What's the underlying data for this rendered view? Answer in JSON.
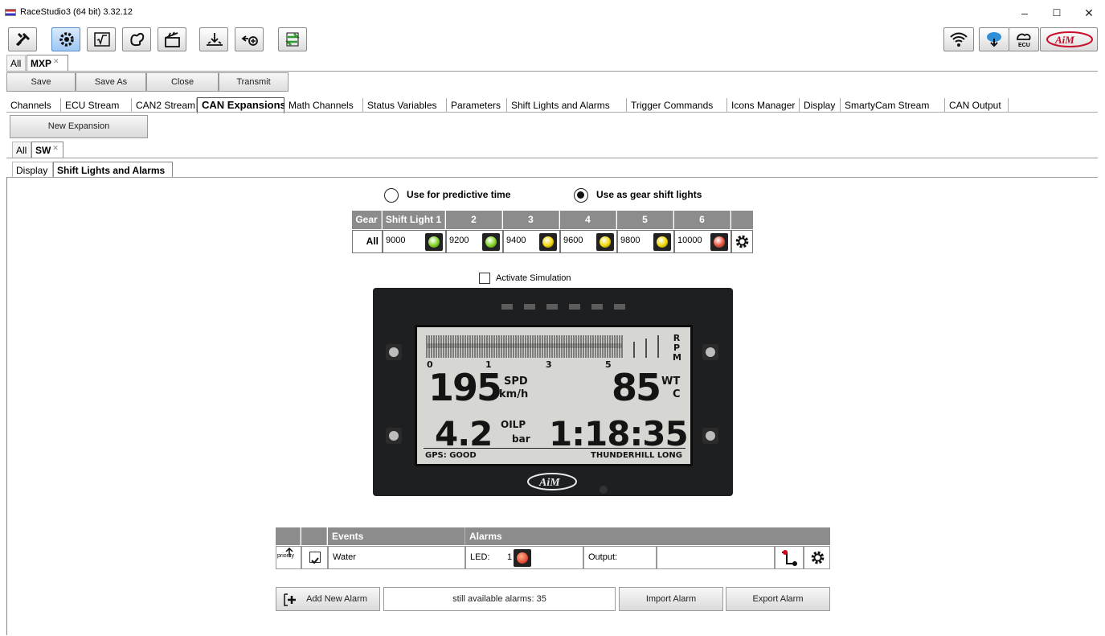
{
  "window": {
    "title": "RaceStudio3 (64 bit) 3.32.12",
    "minimize": "–",
    "maximize": "☐",
    "close": "✕"
  },
  "outer_tabs": {
    "all": "All",
    "device": "MXP"
  },
  "actions": {
    "save": "Save",
    "save_as": "Save As",
    "close": "Close",
    "transmit": "Transmit"
  },
  "config_tabs": [
    "Channels",
    "ECU Stream",
    "CAN2 Stream",
    "CAN Expansions",
    "Math Channels",
    "Status Variables",
    "Parameters",
    "Shift Lights and Alarms",
    "Trigger Commands",
    "Icons Manager",
    "Display",
    "SmartyCam Stream",
    "CAN Output"
  ],
  "new_expansion": "New Expansion",
  "expansion_tabs": {
    "all": "All",
    "sw": "SW"
  },
  "sub_tabs": [
    "Display",
    "Shift Lights and Alarms"
  ],
  "mode": {
    "predictive": "Use for predictive time",
    "gear_shift": "Use as gear shift lights",
    "selected": "gear_shift"
  },
  "shift_table": {
    "headers": [
      "Gear",
      "Shift Light 1",
      "2",
      "3",
      "4",
      "5",
      "6"
    ],
    "row_label": "All",
    "values": [
      "9000",
      "9200",
      "9400",
      "9600",
      "9800",
      "10000"
    ],
    "led_colors": [
      "#7ed321",
      "#7ed321",
      "#f2d600",
      "#f2d600",
      "#f2d600",
      "#e8503a"
    ]
  },
  "simulation": {
    "label": "Activate Simulation",
    "checked": false
  },
  "device_screen": {
    "rpm_label": [
      "R",
      "P",
      "M"
    ],
    "scale": [
      "0",
      "1",
      "3",
      "5"
    ],
    "speed": "195",
    "speed_label": "SPD",
    "speed_unit": "km/h",
    "water": "85",
    "water_label": "WT",
    "water_unit": "C",
    "oil": "4.2",
    "oil_label": "OILP",
    "oil_unit": "bar",
    "laptime": "1:18:35",
    "gps": "GPS: GOOD",
    "track": "THUNDERHILL LONG",
    "logo": "AiM"
  },
  "alarms": {
    "headers": {
      "events": "Events",
      "alarms": "Alarms"
    },
    "priority": "priority",
    "rows": [
      {
        "checked": true,
        "event": "Water",
        "led_label": "LED:",
        "led_num": "1",
        "output_label": "Output:"
      }
    ],
    "add_button": "Add New Alarm",
    "available": "still available alarms: 35",
    "import": "Import Alarm",
    "export": "Export Alarm"
  },
  "brand": "AiM"
}
